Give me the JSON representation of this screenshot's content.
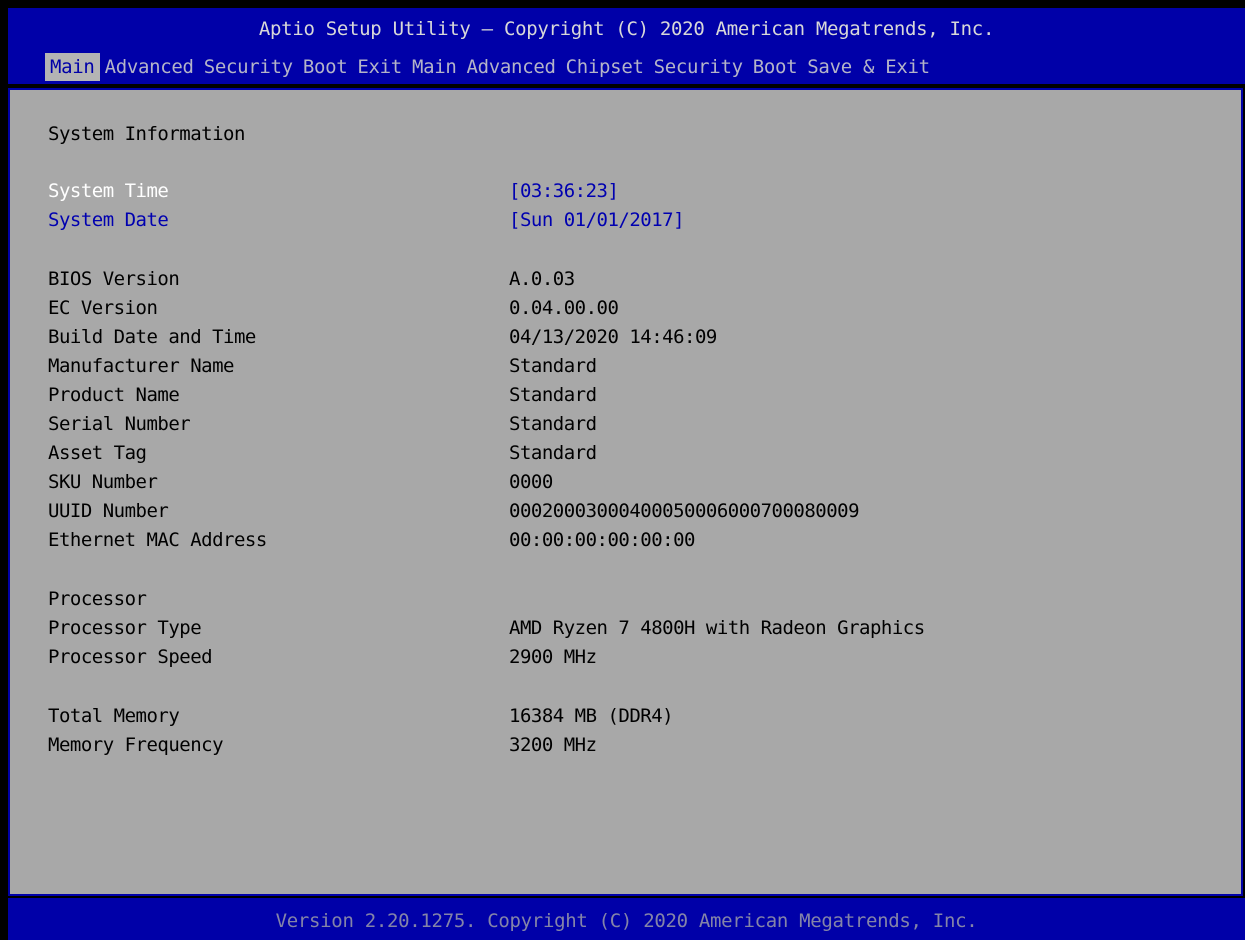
{
  "header": {
    "title": "Aptio Setup Utility – Copyright (C) 2020 American Megatrends, Inc.",
    "tabs": [
      "Main",
      "Advanced",
      "Security",
      "Boot",
      "Exit",
      "Main",
      "Advanced",
      "Chipset",
      "Security",
      "Boot",
      "Save & Exit"
    ]
  },
  "main": {
    "section_title": "System Information",
    "system_time": {
      "label": "System Time",
      "value": "[03:36:23]"
    },
    "system_date": {
      "label": "System Date",
      "value": "[Sun 01/01/2017]"
    },
    "info": [
      {
        "label": "BIOS Version",
        "value": "A.0.03"
      },
      {
        "label": "EC Version",
        "value": "0.04.00.00"
      },
      {
        "label": "Build Date and Time",
        "value": "04/13/2020 14:46:09"
      },
      {
        "label": "Manufacturer Name",
        "value": "Standard"
      },
      {
        "label": "Product Name",
        "value": "Standard"
      },
      {
        "label": "Serial Number",
        "value": "Standard"
      },
      {
        "label": "Asset Tag",
        "value": "Standard"
      },
      {
        "label": "SKU Number",
        "value": "0000"
      },
      {
        "label": "UUID Number",
        "value": "00020003000400050006000700080009"
      },
      {
        "label": "Ethernet MAC Address",
        "value": "00:00:00:00:00:00"
      }
    ],
    "processor_heading": "Processor",
    "processor": [
      {
        "label": "Processor Type",
        "value": "AMD Ryzen 7 4800H with Radeon Graphics"
      },
      {
        "label": "Processor Speed",
        "value": "2900 MHz"
      }
    ],
    "memory": [
      {
        "label": "Total Memory",
        "value": "16384 MB (DDR4)"
      },
      {
        "label": "Memory Frequency",
        "value": "3200 MHz"
      }
    ]
  },
  "footer": {
    "text": "Version 2.20.1275. Copyright (C) 2020 American Megatrends, Inc."
  },
  "colors": {
    "bar_blue": "#0000a8",
    "panel_gray": "#a8a8a8",
    "highlight_white": "#ffffff",
    "selectable_blue": "#0000b0"
  }
}
